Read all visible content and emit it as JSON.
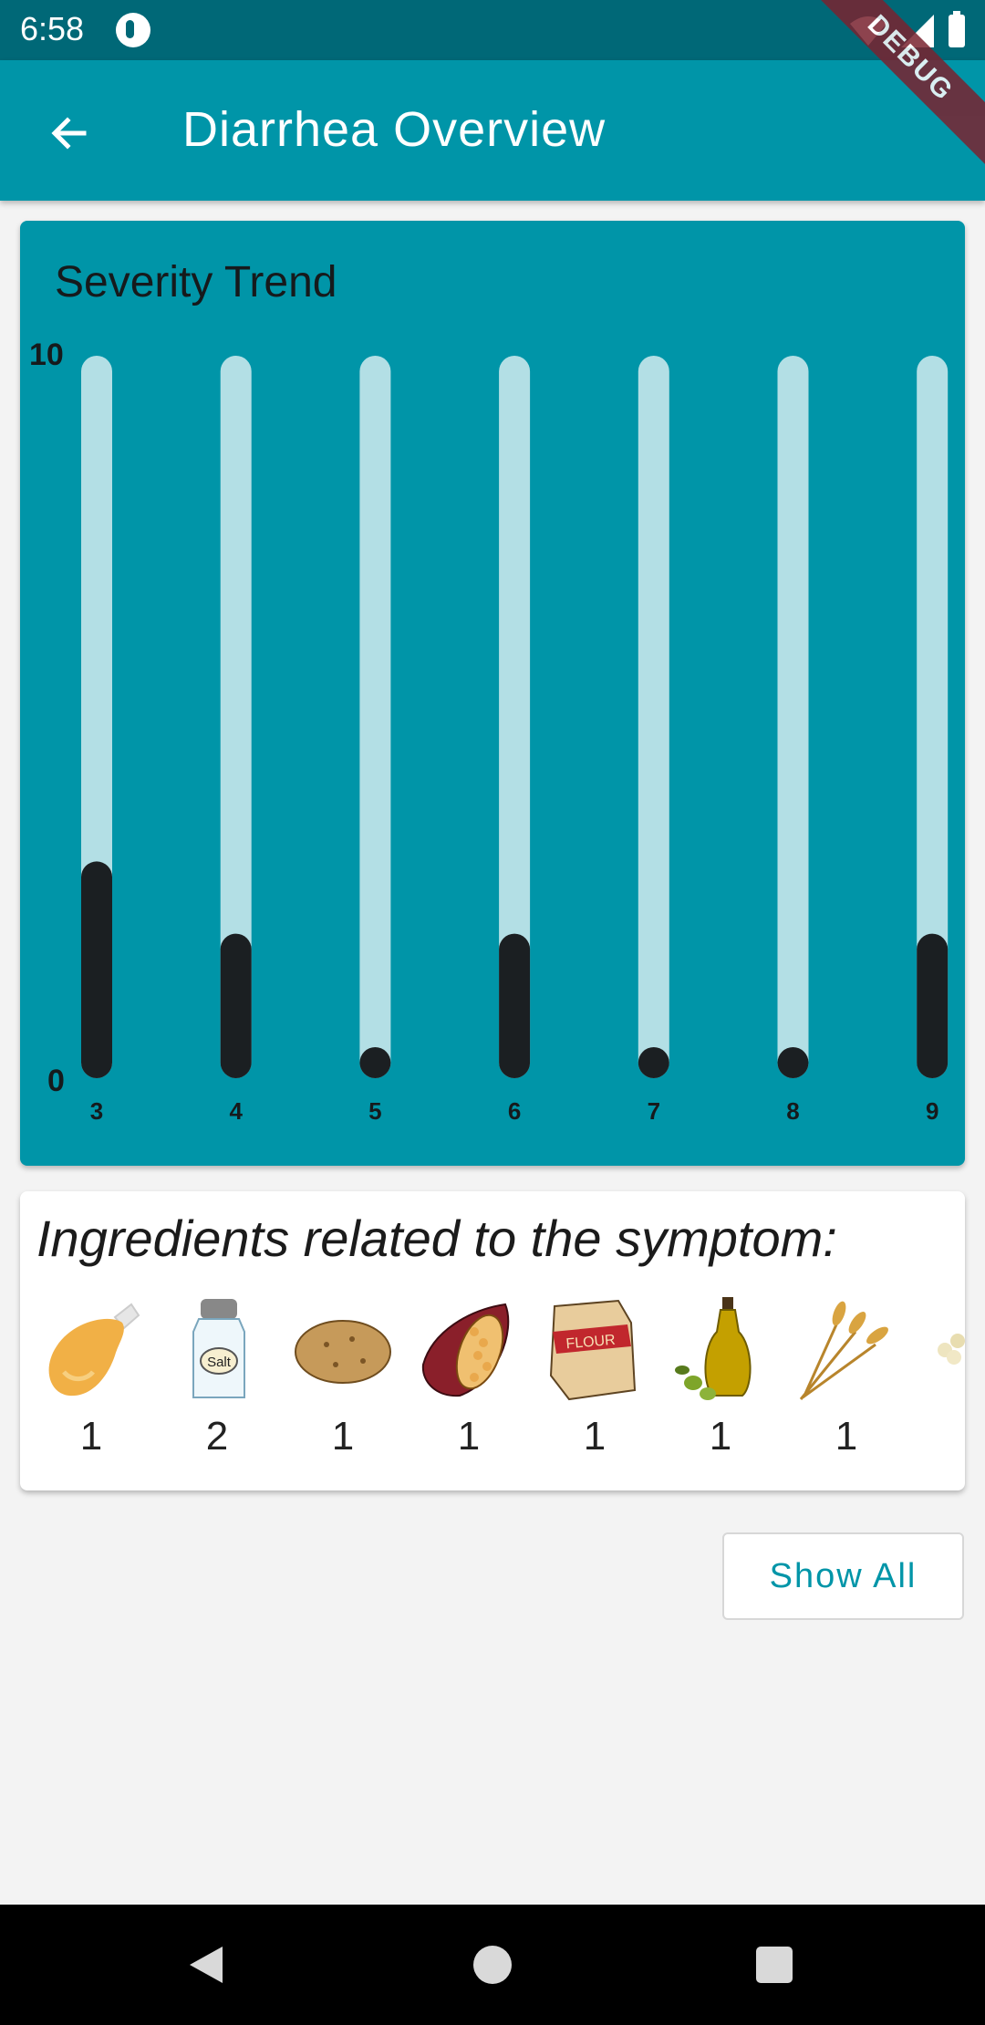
{
  "status_bar": {
    "time": "6:58"
  },
  "debug_label": "DEBUG",
  "app_bar": {
    "title": "Diarrhea Overview",
    "back_icon": "arrow-left-icon"
  },
  "chart": {
    "title": "Severity Trend",
    "y_max_label": "10",
    "y_min_label": "0"
  },
  "chart_data": {
    "type": "bar",
    "title": "Severity Trend",
    "categories": [
      "3",
      "4",
      "5",
      "6",
      "7",
      "8",
      "9"
    ],
    "values": [
      3,
      2,
      0,
      2,
      0,
      0,
      2
    ],
    "ylim": [
      0,
      10
    ],
    "colors": {
      "track": "#b3dfe5",
      "fill": "#1b1f22",
      "background": "#0095a8"
    }
  },
  "ingredients": {
    "heading": "Ingredients related to the symptom:",
    "items": [
      {
        "name": "chicken-leg-icon",
        "count": "1"
      },
      {
        "name": "salt-shaker-icon",
        "count": "2",
        "label": "Salt"
      },
      {
        "name": "potato-icon",
        "count": "1"
      },
      {
        "name": "cocoa-pod-icon",
        "count": "1"
      },
      {
        "name": "flour-bag-icon",
        "count": "1",
        "label": "FLOUR"
      },
      {
        "name": "olive-oil-icon",
        "count": "1"
      },
      {
        "name": "wheat-icon",
        "count": "1"
      }
    ]
  },
  "show_all_label": "Show All",
  "colors": {
    "primary": "#0095a8",
    "status_bar": "#006877",
    "button_text": "#0095a8"
  }
}
